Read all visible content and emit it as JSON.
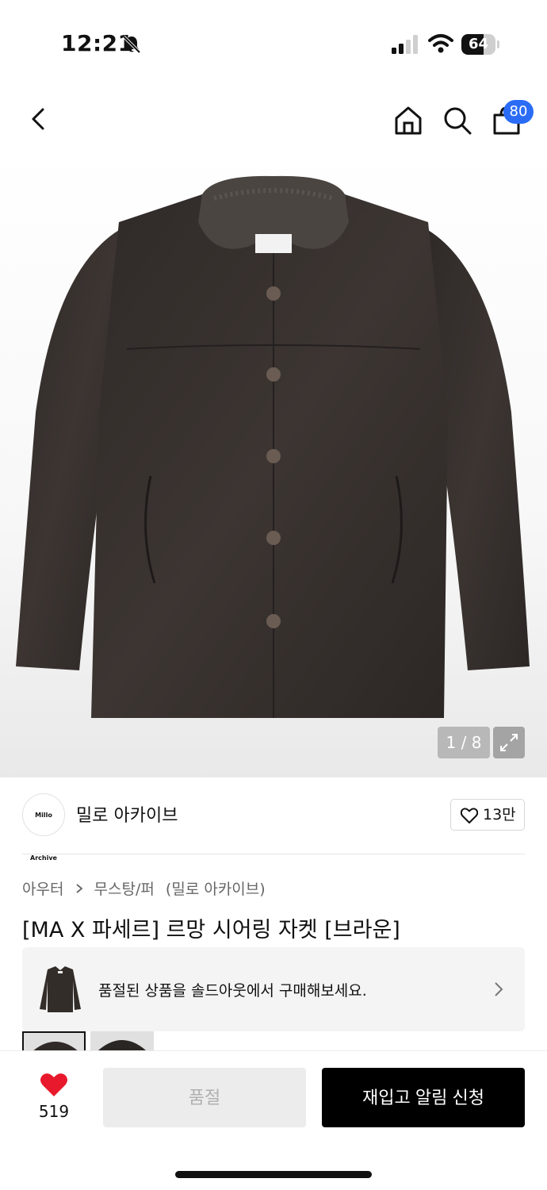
{
  "status_bar": {
    "time": "12:21",
    "battery_percent": 64,
    "battery_label": "64"
  },
  "nav": {
    "cart_count": "80",
    "icons": [
      "back-icon",
      "home-icon",
      "search-icon",
      "cart-icon"
    ]
  },
  "gallery": {
    "counter": "1 / 8",
    "current_index": 1,
    "total": 8
  },
  "brand": {
    "logo_text": "Millo Archive",
    "name": "밀로 아카이브",
    "like_count": "13만"
  },
  "breadcrumb": {
    "category": "아우터",
    "subcategory": "무스탕/퍼",
    "brand": "(밀로 아카이브)"
  },
  "product": {
    "title": "[MA X 파세르] 르망 시어링 자켓 [브라운]"
  },
  "soldout_banner": {
    "text": "품절된 상품을 솔드아웃에서 구매해보세요."
  },
  "bottom_bar": {
    "wish_count": "519",
    "soldout_label": "품절",
    "restock_label": "재입고 알림 신청"
  },
  "colors": {
    "accent_blue": "#2b6cf6",
    "heart_red": "#e8192c",
    "jacket_brown": "#3a3431"
  }
}
